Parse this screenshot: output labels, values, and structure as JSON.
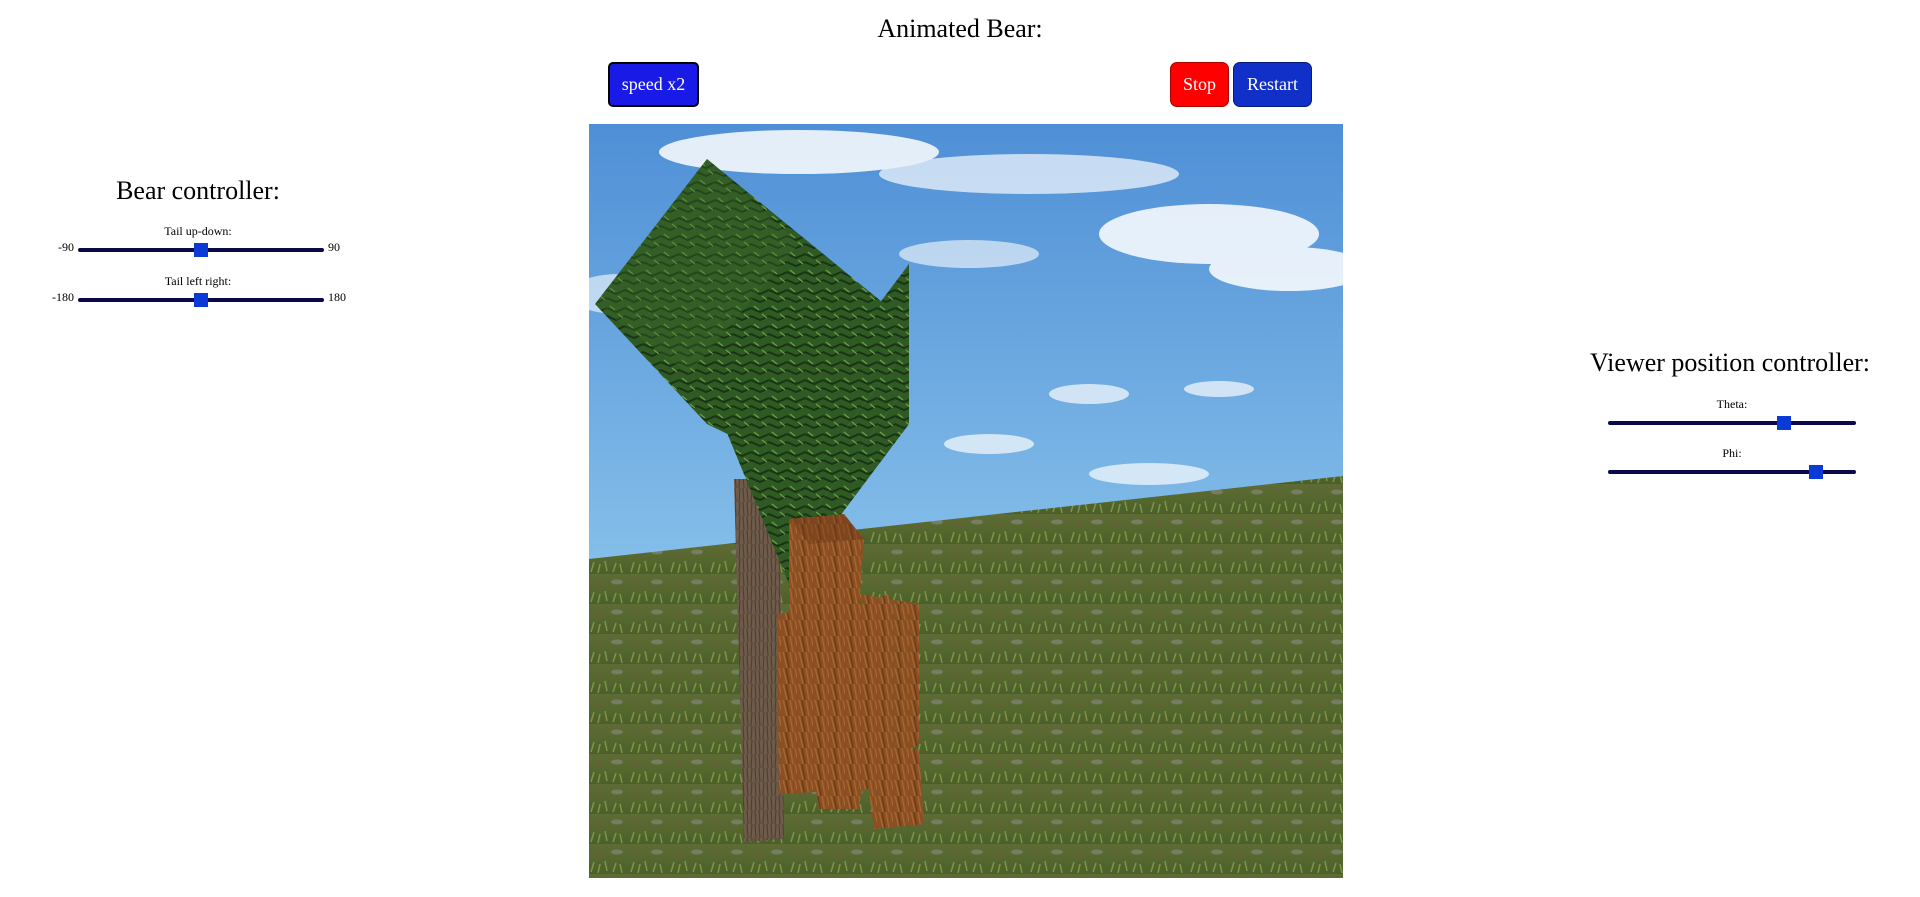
{
  "page": {
    "title": "Animated Bear:"
  },
  "controls": {
    "speed_label": "speed x2",
    "stop_label": "Stop",
    "restart_label": "Restart",
    "colors": {
      "speed": "#1a1ae6",
      "stop": "#ff0000",
      "restart": "#1030c8"
    }
  },
  "bear_controller": {
    "title": "Bear controller:",
    "sliders": [
      {
        "label": "Tail up-down:",
        "min": "-90",
        "max": "90",
        "value": 0
      },
      {
        "label": "Tail left right:",
        "min": "-180",
        "max": "180",
        "value": 0
      }
    ]
  },
  "viewer_controller": {
    "title": "Viewer position controller:",
    "sliders": [
      {
        "label": "Theta:",
        "fraction": 0.71
      },
      {
        "label": "Phi:",
        "fraction": 0.84
      }
    ]
  },
  "scene": {
    "icons": [
      "sky",
      "clouds",
      "grass-hill",
      "pine-tree",
      "bear"
    ]
  }
}
